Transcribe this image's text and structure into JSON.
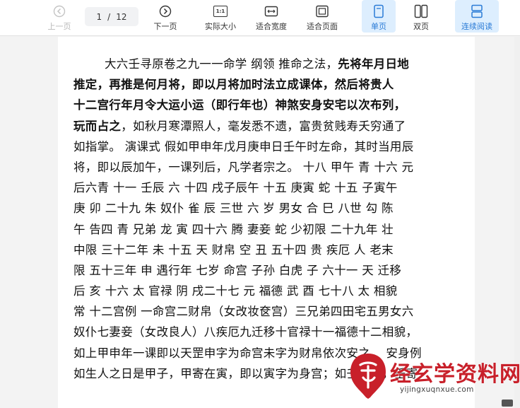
{
  "toolbar": {
    "prev_label": "上一页",
    "page_current": "1",
    "page_sep": "/",
    "page_total": "12",
    "next_label": "下一页",
    "actual_size_label": "实际大小",
    "actual_size_glyph": "1:1",
    "fit_width_label": "适合宽度",
    "fit_page_label": "适合页面",
    "single_label": "单页",
    "double_label": "双页",
    "continuous_label": "连续阅读",
    "accent_color": "#2a7bd6"
  },
  "document": {
    "lines": [
      {
        "id": "l1",
        "segments": [
          {
            "t": "大六壬寻原卷之九一一命学 纲领 推命之法，",
            "b": false
          },
          {
            "t": "先将年月日地",
            "b": true
          }
        ],
        "indent": true
      },
      {
        "id": "l2",
        "segments": [
          {
            "t": "推定，再推是何月将，即以月将加时法立成课体，然后将贵人",
            "b": true
          }
        ]
      },
      {
        "id": "l3",
        "segments": [
          {
            "t": "十二宫行年月令大运小运（即行年也）神煞安身安宅以次布列，",
            "b": true
          }
        ]
      },
      {
        "id": "l4",
        "segments": [
          {
            "t": "玩而占之",
            "b": true
          },
          {
            "t": "，如秋月寒潭照人，毫发悉不遗，富贵贫贱寿夭穷通了",
            "b": false
          }
        ]
      },
      {
        "id": "l5",
        "segments": [
          {
            "t": "如指掌。 演课式 假如甲申年戊月庚申日壬午时左命，其时当用辰",
            "b": false
          }
        ]
      },
      {
        "id": "l6",
        "segments": [
          {
            "t": "将，即以辰加午，一课列后，凡学者宗之。 十八 甲午 青 十六 元",
            "b": false
          }
        ]
      },
      {
        "id": "l7",
        "segments": [
          {
            "t": "后六青 十一 壬辰 六 十四 戌子辰午 十五 庚寅 蛇 十五 子寅午",
            "b": false
          }
        ]
      },
      {
        "id": "l8",
        "segments": [
          {
            "t": "庚 卯 二十九 朱 奴仆 雀 辰 三世 六 岁 男女 合 巳 八世 勾 陈",
            "b": false
          }
        ]
      },
      {
        "id": "l9",
        "segments": [
          {
            "t": "午 告四 青 兄弟 龙 寅 四十六 腾 妻妾 蛇 少初限 二十九年 壮",
            "b": false
          }
        ]
      },
      {
        "id": "l10",
        "segments": [
          {
            "t": "中限 三十二年 未 十五 天 财帛 空 丑 五十四 贵 疾厄 人 老末",
            "b": false
          }
        ]
      },
      {
        "id": "l11",
        "segments": [
          {
            "t": "限 五十三年 申 遇行年 七岁 命宫 子孙 白虎 子 六十一 天 迁移",
            "b": false
          }
        ]
      },
      {
        "id": "l12",
        "segments": [
          {
            "t": "后 亥 十六 太 官禄 阴 戌二十七 元 福德 武 酉 七十八 太 相貌",
            "b": false
          }
        ]
      },
      {
        "id": "l13",
        "segments": [
          {
            "t": "常 十二宫例 一命宫二财帛（女改妆奁宫）三兄弟四田宅五男女六",
            "b": false
          }
        ]
      },
      {
        "id": "l14",
        "segments": [
          {
            "t": "奴仆七妻妾（女改良人）八疾厄九迁移十官禄十一福德十二相貌，",
            "b": false
          }
        ]
      },
      {
        "id": "l15",
        "segments": [
          {
            "t": "如上甲申年一课即以天罡申字为命宫未字为财帛依次安之。 安身例",
            "b": false
          }
        ]
      },
      {
        "id": "l16",
        "segments": [
          {
            "t": "如生人之日是甲子，甲寄在寅，即以寅字为身宫；如壬午日，壬寄",
            "b": false
          }
        ]
      }
    ]
  },
  "watermark": {
    "title": "经玄学资料网",
    "url": "yijingxuqnxue.com",
    "color": "#c8202a"
  }
}
